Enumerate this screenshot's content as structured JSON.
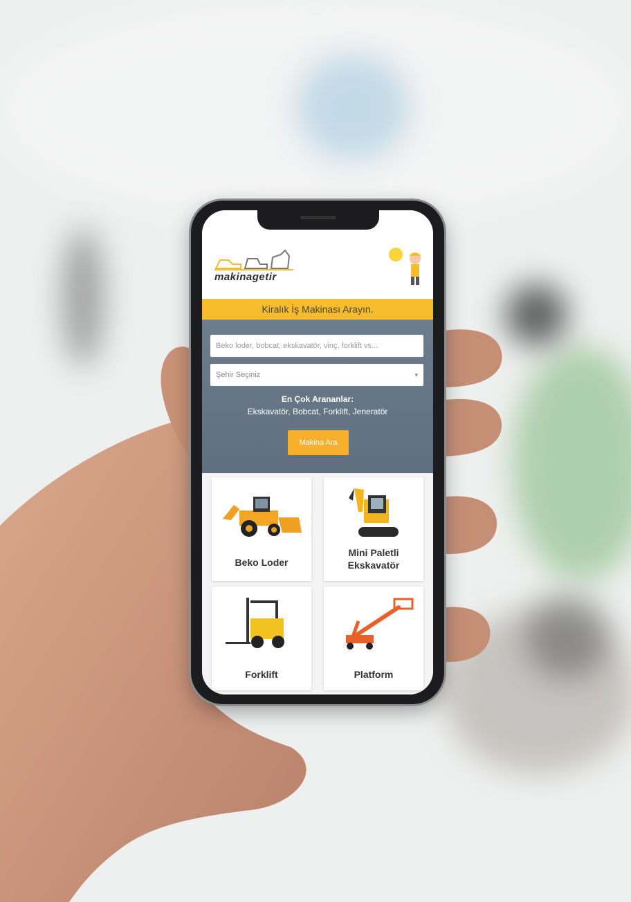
{
  "brand": {
    "logo_text": "makinagetir"
  },
  "banner": {
    "text": "Kiralık İş Makinası Arayın."
  },
  "search": {
    "placeholder": "Beko loder, bobcat, ekskavatör, vinç, forklift vs...",
    "city_select": "Şehir Seçiniz",
    "popular_title": "En Çok Arananlar:",
    "popular_items": "Ekskavatör, Bobcat, Forklift, Jeneratör",
    "button_label": "Makina Ara"
  },
  "categories": [
    {
      "label": "Beko Loder",
      "icon": "backhoe-loader-icon"
    },
    {
      "label": "Mini Paletli Ekskavatör",
      "icon": "mini-excavator-icon"
    },
    {
      "label": "Forklift",
      "icon": "forklift-icon"
    },
    {
      "label": "Platform",
      "icon": "boom-lift-icon"
    }
  ],
  "colors": {
    "accent": "#f7bc2b",
    "panel": "#66768a",
    "phone": "#1c1c1e"
  }
}
